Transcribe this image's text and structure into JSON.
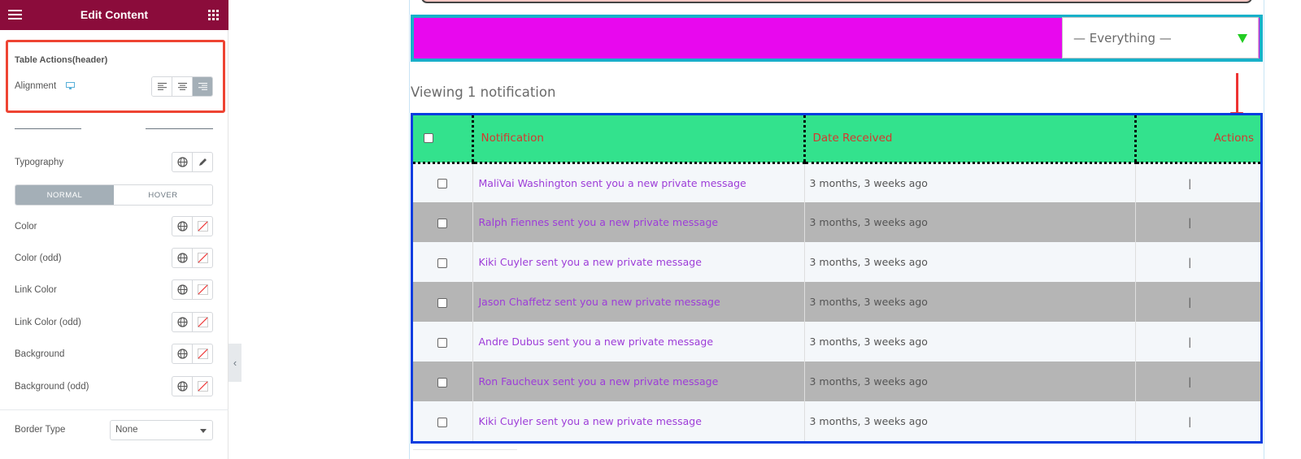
{
  "panel": {
    "title": "Edit Content",
    "section_title": "Table Actions(header)",
    "alignment_label": "Alignment",
    "typography_label": "Typography",
    "tabs": [
      "NORMAL",
      "HOVER"
    ],
    "controls": [
      "Color",
      "Color (odd)",
      "Link Color",
      "Link Color (odd)",
      "Background",
      "Background (odd)"
    ],
    "border_type_label": "Border Type",
    "border_type_value": "None"
  },
  "preview": {
    "filter_value": "— Everything —",
    "viewing_text": "Viewing 1 notification",
    "columns": [
      "Notification",
      "Date Received",
      "Actions"
    ],
    "rows": [
      {
        "notification": "MaliVai Washington sent you a new private message",
        "date": "3 months, 3 weeks ago",
        "action": "|"
      },
      {
        "notification": "Ralph Fiennes sent you a new private message",
        "date": "3 months, 3 weeks ago",
        "action": "|"
      },
      {
        "notification": "Kiki Cuyler sent you a new private message",
        "date": "3 months, 3 weeks ago",
        "action": "|"
      },
      {
        "notification": "Jason Chaffetz sent you a new private message",
        "date": "3 months, 3 weeks ago",
        "action": "|"
      },
      {
        "notification": "Andre Dubus sent you a new private message",
        "date": "3 months, 3 weeks ago",
        "action": "|"
      },
      {
        "notification": "Ron Faucheux sent you a new private message",
        "date": "3 months, 3 weeks ago",
        "action": "|"
      },
      {
        "notification": "Kiki Cuyler sent you a new private message",
        "date": "3 months, 3 weeks ago",
        "action": "|"
      }
    ]
  },
  "colors": {
    "panel_header": "#8b0c3b",
    "filter_bar": "#e808ee",
    "filter_border": "#18b1c9",
    "table_border": "#0a3de0",
    "header_bg": "#33e28d",
    "header_text": "#d4382e",
    "link_text": "#9d3cd8",
    "row_odd": "#b5b5b5",
    "highlight": "#ee4433"
  }
}
